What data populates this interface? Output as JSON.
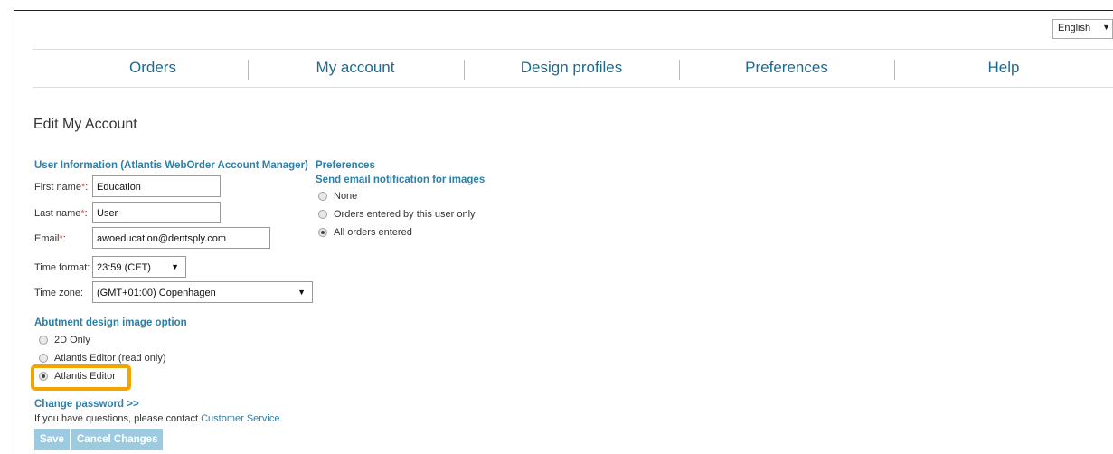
{
  "language": {
    "selected": "English"
  },
  "nav": {
    "items": [
      {
        "label": "Orders"
      },
      {
        "label": "My account"
      },
      {
        "label": "Design profiles"
      },
      {
        "label": "Preferences"
      },
      {
        "label": "Help"
      }
    ]
  },
  "page_title": "Edit My Account",
  "user_info": {
    "heading": "User Information (Atlantis WebOrder Account Manager)",
    "first_name": {
      "label": "First name",
      "value": "Education"
    },
    "last_name": {
      "label": "Last name",
      "value": "User"
    },
    "email": {
      "label": "Email",
      "value": "awoeducation@dentsply.com"
    },
    "required_mark": "*",
    "time_format": {
      "label": "Time format:",
      "value": "23:59 (CET)"
    },
    "time_zone": {
      "label": "Time zone:",
      "value": "(GMT+01:00) Copenhagen"
    }
  },
  "preferences": {
    "heading": "Preferences",
    "subheading": "Send email notification for images",
    "options": [
      {
        "label": "None",
        "selected": false
      },
      {
        "label": "Orders entered by this user only",
        "selected": false
      },
      {
        "label": "All orders entered",
        "selected": true
      }
    ]
  },
  "abutment": {
    "heading": "Abutment design image option",
    "options": [
      {
        "label": "2D Only",
        "selected": false
      },
      {
        "label": "Atlantis Editor (read only)",
        "selected": false
      },
      {
        "label": "Atlantis Editor",
        "selected": true
      }
    ],
    "highlight_color": "#f1a500"
  },
  "footer": {
    "change_password": "Change password >>",
    "contact_text": "If you have questions, please contact",
    "contact_link": "Customer Service",
    "contact_end": "."
  },
  "buttons": {
    "save": "Save",
    "cancel": "Cancel Changes"
  },
  "colors": {
    "accent": "#2e7fa6",
    "nav_text": "#1d6a8f",
    "button_bg": "#9ccbe0"
  },
  "icons": {
    "dropdown": "triangle-down-icon",
    "radio": "radio-icon"
  }
}
